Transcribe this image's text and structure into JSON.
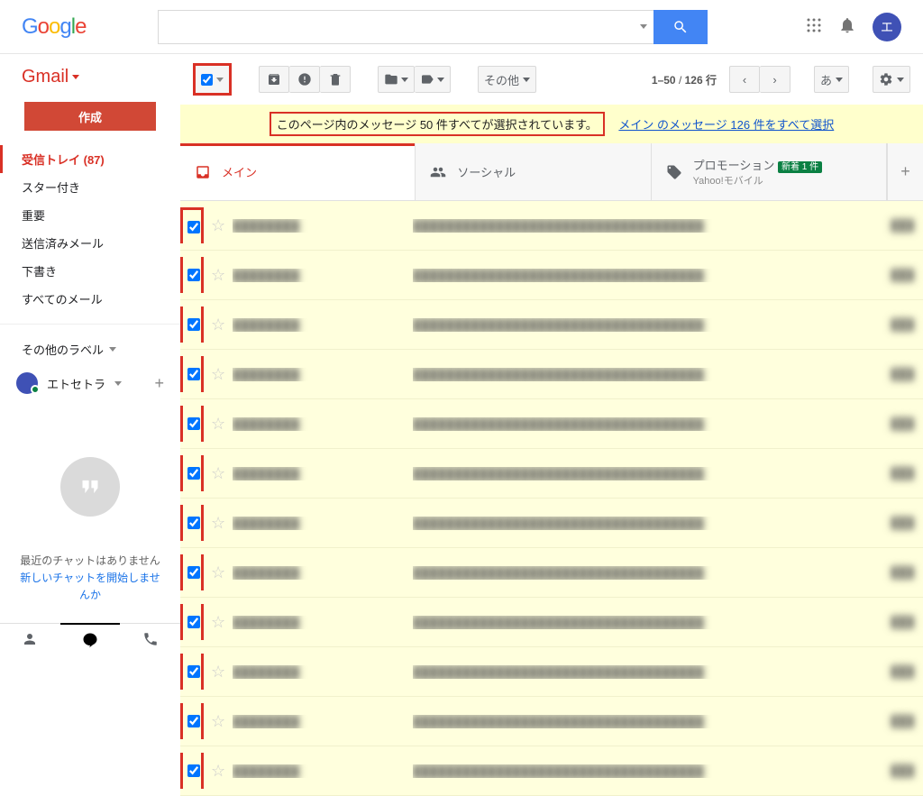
{
  "header": {
    "logo_parts": [
      "G",
      "o",
      "o",
      "g",
      "l",
      "e"
    ],
    "search_placeholder": "",
    "avatar_letter": "エ"
  },
  "sidebar": {
    "product": "Gmail",
    "compose": "作成",
    "items": [
      {
        "label": "受信トレイ (87)",
        "active": true
      },
      {
        "label": "スター付き"
      },
      {
        "label": "重要"
      },
      {
        "label": "送信済みメール"
      },
      {
        "label": "下書き"
      },
      {
        "label": "すべてのメール"
      }
    ],
    "more_labels": "その他のラベル",
    "profile_name": "エトセトラ",
    "hangouts_empty": "最近のチャットはありません",
    "hangouts_link": "新しいチャットを開始しませんか"
  },
  "toolbar": {
    "other": "その他",
    "counter_range": "1–50",
    "counter_sep": " / ",
    "counter_total": "126 行",
    "lang": "あ"
  },
  "banner": {
    "selected": "このページ内のメッセージ 50 件すべてが選択されています。",
    "link": "メイン のメッセージ 126 件をすべて選択"
  },
  "tabs": {
    "main": "メイン",
    "social": "ソーシャル",
    "promo": "プロモーション",
    "promo_badge": "新着 1 件",
    "promo_sub": "Yahoo!モバイル"
  },
  "rows_count": 12
}
